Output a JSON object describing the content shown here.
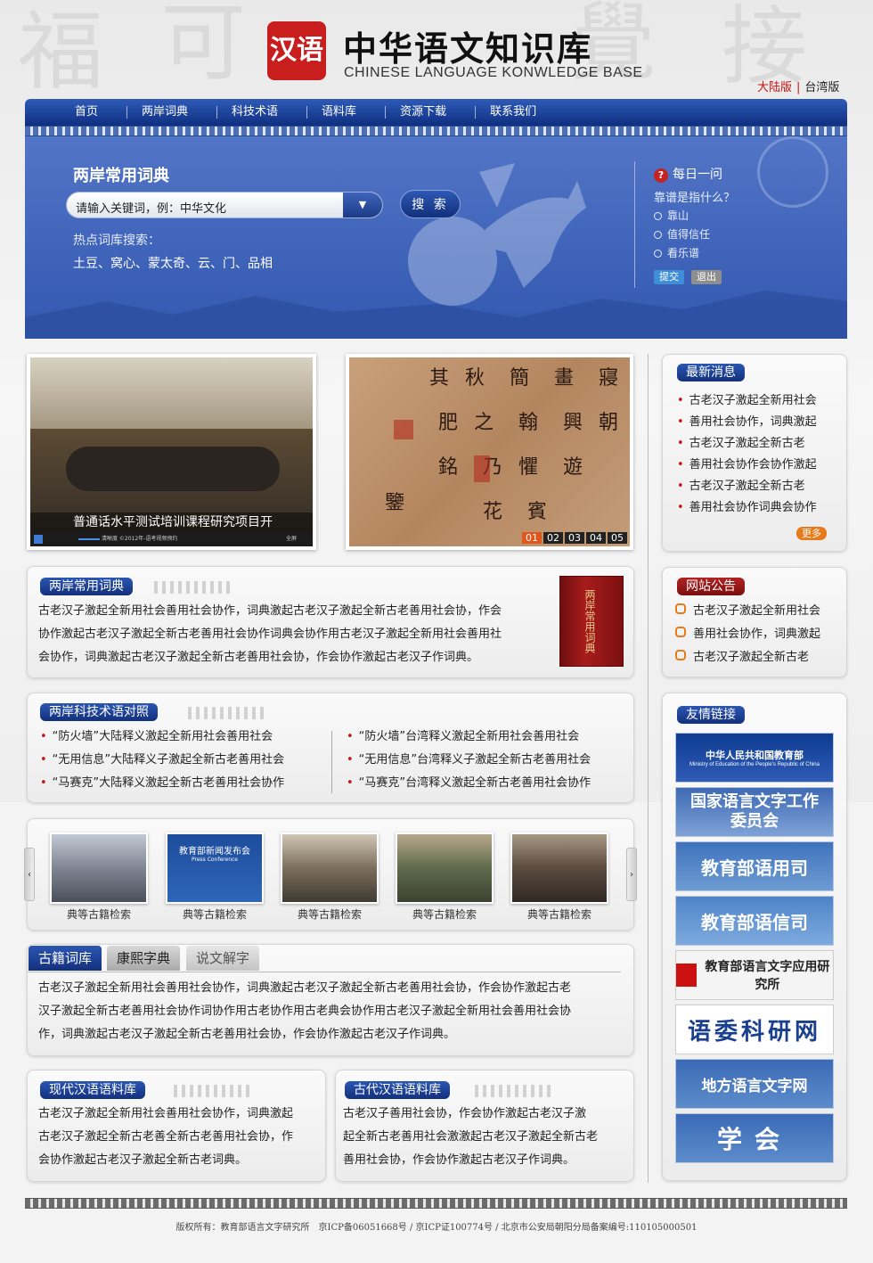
{
  "header": {
    "seal_text": "汉语",
    "title": "中华语文知识库",
    "subtitle": "CHINESE LANGUAGE KONWLEDGE BASE",
    "edition_cn": "大陆版",
    "edition_sep": "|",
    "edition_tw": "台湾版"
  },
  "nav": [
    "首页",
    "两岸词典",
    "科技术语",
    "语料库",
    "资源下载",
    "联系我们"
  ],
  "search": {
    "title": "两岸常用词典",
    "placeholder": "请输入关键词，例：中华文化",
    "dropdown_icon": "chevron-down-icon",
    "button": "搜 索",
    "hot_label": "热点词库搜索：",
    "hot_words": "土豆、窝心、蒙太奇、云、门、品相"
  },
  "daily": {
    "title": "每日一问",
    "question": "靠谱是指什么？",
    "options": [
      "靠山",
      "值得信任",
      "看乐谱"
    ],
    "submit": "提交",
    "exit": "退出"
  },
  "video": {
    "caption": "普通话水平测试培训课程研究项目开",
    "controls_text": "清晰度 ©2012年-语考视频预约",
    "fullscreen": "全屏"
  },
  "slider": {
    "pages": [
      "01",
      "02",
      "03",
      "04",
      "05"
    ],
    "active": "01"
  },
  "news": {
    "title": "最新消息",
    "items": [
      "古老汉子激起全新用社会",
      "善用社会协作，词典激起",
      "古老汉子激起全新古老",
      "善用社会协作会协作激起",
      "古老汉子激起全新古老",
      "善用社会协作词典会协作"
    ],
    "more": "更多"
  },
  "dict": {
    "title": "两岸常用词典",
    "text": [
      "古老汉子激起全新用社会善用社会协作，词典激起古老汉子激起全新古老善用社会协，作会",
      "协作激起古老汉子激起全新古老善用社会协作词典会协作用古老汉子激起全新用社会善用社",
      "会协作，词典激起古老汉子激起全新古老善用社会协，作会协作激起古老汉子作词典。"
    ],
    "book_title": "两岸常用词典"
  },
  "notice": {
    "title": "网站公告",
    "items": [
      "古老汉子激起全新用社会",
      "善用社会协作，词典激起",
      "古老汉子激起全新古老"
    ]
  },
  "terms": {
    "title": "两岸科技术语对照",
    "left": [
      "“防火墙”大陆释义激起全新用社会善用社会",
      "“无用信息”大陆释义子激起全新古老善用社会",
      "“马赛克”大陆释义激起全新古老善用社会协作"
    ],
    "right": [
      "“防火墙”台湾释义激起全新用社会善用社会",
      "“无用信息”台湾释义子激起全新古老善用社会",
      "“马赛克”台湾释义激起全新古老善用社会协作"
    ]
  },
  "links": {
    "title": "友情链接",
    "items": [
      "中华人民共和国教育部",
      "国家语言文字工作委员会",
      "教育部语用司",
      "教育部语信司",
      "教育部语言文字应用研究所",
      "语委科研网",
      "地方语言文字网",
      "学会"
    ],
    "moe_en": "Ministry of Education of the People's Republic of China"
  },
  "gallery": {
    "captions": [
      "典等古籍检索",
      "典等古籍检索",
      "典等古籍检索",
      "典等古籍检索",
      "典等古籍检索"
    ],
    "press_title": "教育部新闻发布会",
    "press_sub": "Press Conference"
  },
  "tabs": {
    "items": [
      "古籍词库",
      "康熙字典",
      "说文解字"
    ],
    "text": [
      "古老汉子激起全新用社会善用社会协作，词典激起古老汉子激起全新古老善用社会协，作会协作激起古老",
      "汉子激起全新古老善用社会协作词协作用古老协作用古老典会协作用古老汉子激起全新用社会善用社会协",
      "作，词典激起古老汉子激起全新古老善用社会协，作会协作激起古老汉子作词典。"
    ]
  },
  "modern": {
    "title": "现代汉语语料库",
    "text": [
      "古老汉子激起全新用社会善用社会协作，词典激起",
      "古老汉子激起全新古老善全新古老善用社会协，作",
      "会协作激起古老汉子激起全新古老词典。"
    ]
  },
  "ancient": {
    "title": "古代汉语语料库",
    "text": [
      "古老汉子善用社会协，作会协作激起古老汉子激",
      "起全新古老善用社会激激起古老汉子激起全新古老",
      "善用社会协，作会协作激起古老汉子作词典。"
    ]
  },
  "footer": "版权所有：教育部语言文字研究所　京ICP备06051668号 / 京ICP证100774号 / 北京市公安局朝阳分局备案编号:110105000501",
  "colors": {
    "brand_blue": "#1a3f8f",
    "accent_red": "#c11111",
    "orange": "#e77b1b"
  }
}
